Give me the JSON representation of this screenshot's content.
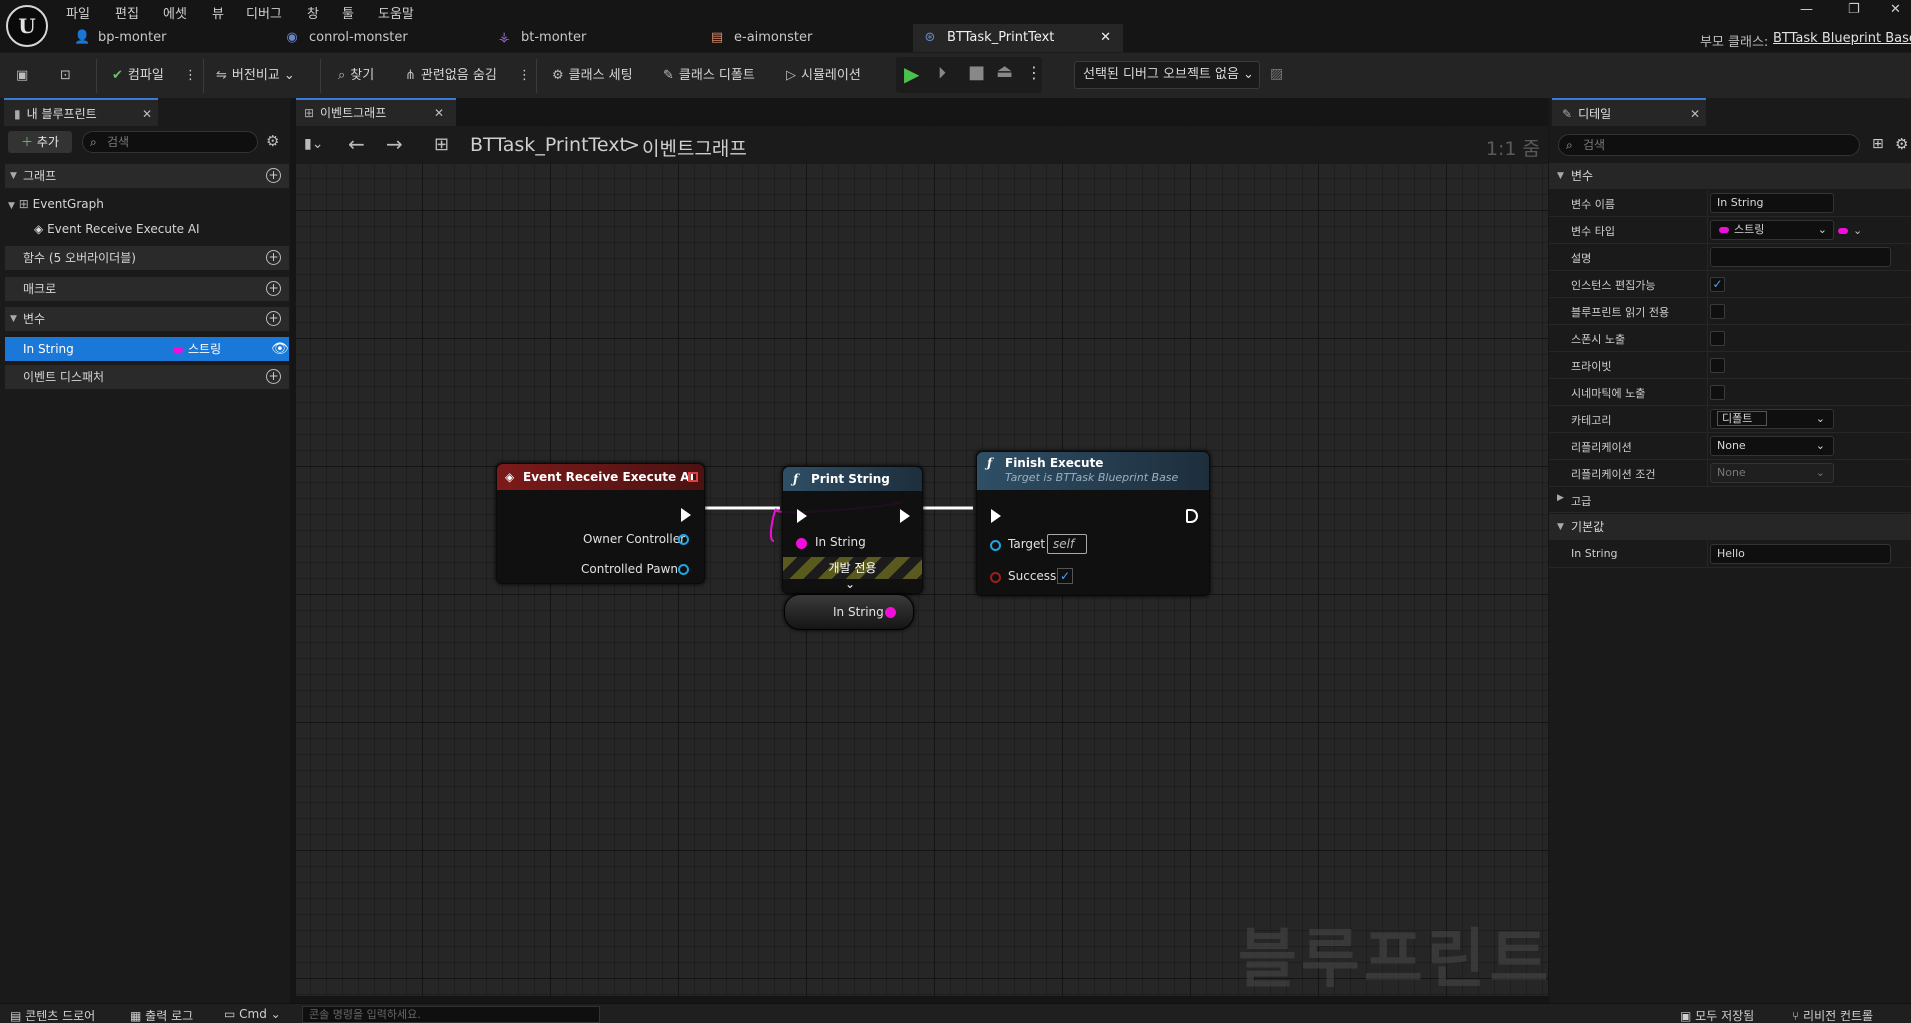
{
  "menu": [
    "파일",
    "편집",
    "에셋",
    "뷰",
    "디버그",
    "창",
    "툴",
    "도움말"
  ],
  "tabs": [
    {
      "label": "bp-monter",
      "icon": "person-icon"
    },
    {
      "label": "conrol-monster",
      "icon": "controller-icon"
    },
    {
      "label": "bt-monter",
      "icon": "behavior-tree-icon"
    },
    {
      "label": "e-aimonster",
      "icon": "blackboard-icon"
    },
    {
      "label": "BTTask_PrintText",
      "icon": "blueprint-icon"
    }
  ],
  "parent_class": {
    "label": "부모 클래스:",
    "value": "BTTask Blueprint Base"
  },
  "toolbar": {
    "compile": "컴파일",
    "diff": "버전비교",
    "find": "찾기",
    "hide_unrelated": "관련없음 숨김",
    "class_settings": "클래스 세팅",
    "class_defaults": "클래스 디폴트",
    "simulation": "시뮬레이션",
    "debug_object": "선택된 디버그 오브젝트 없음"
  },
  "my_blueprint": {
    "tab": "내 블루프린트",
    "add": "추가",
    "search_placeholder": "검색",
    "graphs_header": "그래프",
    "event_graph": "EventGraph",
    "event_item": "Event Receive Execute AI",
    "functions_header": "함수 (5 오버라이더블)",
    "macros_header": "매크로",
    "variables_header": "변수",
    "variable": {
      "name": "In String",
      "type": "스트링"
    },
    "dispatchers_header": "이벤트 디스패처"
  },
  "graph": {
    "tab": "이벤트그래프",
    "breadcrumb_root": "BTTask_PrintText",
    "breadcrumb_sep": ">",
    "breadcrumb_current": "이벤트그래프",
    "zoom": "1:1 줌",
    "watermark": "블루프린트"
  },
  "nodes": {
    "event": {
      "title": "Event Receive Execute AI",
      "owner": "Owner Controller",
      "pawn": "Controlled Pawn"
    },
    "print": {
      "title": "Print String",
      "in_string": "In String",
      "dev_only": "개발 전용"
    },
    "getter": {
      "label": "In String"
    },
    "finish": {
      "title": "Finish Execute",
      "subtitle": "Target is BTTask Blueprint Base",
      "target": "Target",
      "target_value": "self",
      "success": "Success"
    }
  },
  "details": {
    "tab": "디테일",
    "search_placeholder": "검색",
    "section_variable": "변수",
    "var_name_label": "변수 이름",
    "var_name": "In String",
    "var_type_label": "변수 타입",
    "var_type": "스트링",
    "desc_label": "설명",
    "instance_editable_label": "인스턴스 편집가능",
    "instance_editable": true,
    "bp_readonly_label": "블루프린트 읽기 전용",
    "bp_readonly": false,
    "expose_spawn_label": "스폰시 노출",
    "expose_spawn": false,
    "private_label": "프라이빗",
    "private": false,
    "expose_cine_label": "시네마틱에 노출",
    "expose_cine": false,
    "category_label": "카테고리",
    "category": "디폴트",
    "replication_label": "리플리케이션",
    "replication": "None",
    "rep_cond_label": "리플리케이션 조건",
    "rep_cond": "None",
    "advanced": "고급",
    "section_default": "기본값",
    "default_label": "In String",
    "default_value": "Hello"
  },
  "bottom": {
    "content_drawer": "콘텐츠 드로어",
    "output_log": "출력 로그",
    "cmd": "Cmd",
    "console_placeholder": "콘솔 명령을 입력하세요.",
    "save_all": "모두 저장됨",
    "revision": "리비전 컨트롤"
  },
  "colors": {
    "accent": "#1a78d8",
    "event_header": "#7d1a1a",
    "function_header": "#2f4f66",
    "string_pin": "#f20ddc",
    "object_pin": "#19a7e8"
  }
}
